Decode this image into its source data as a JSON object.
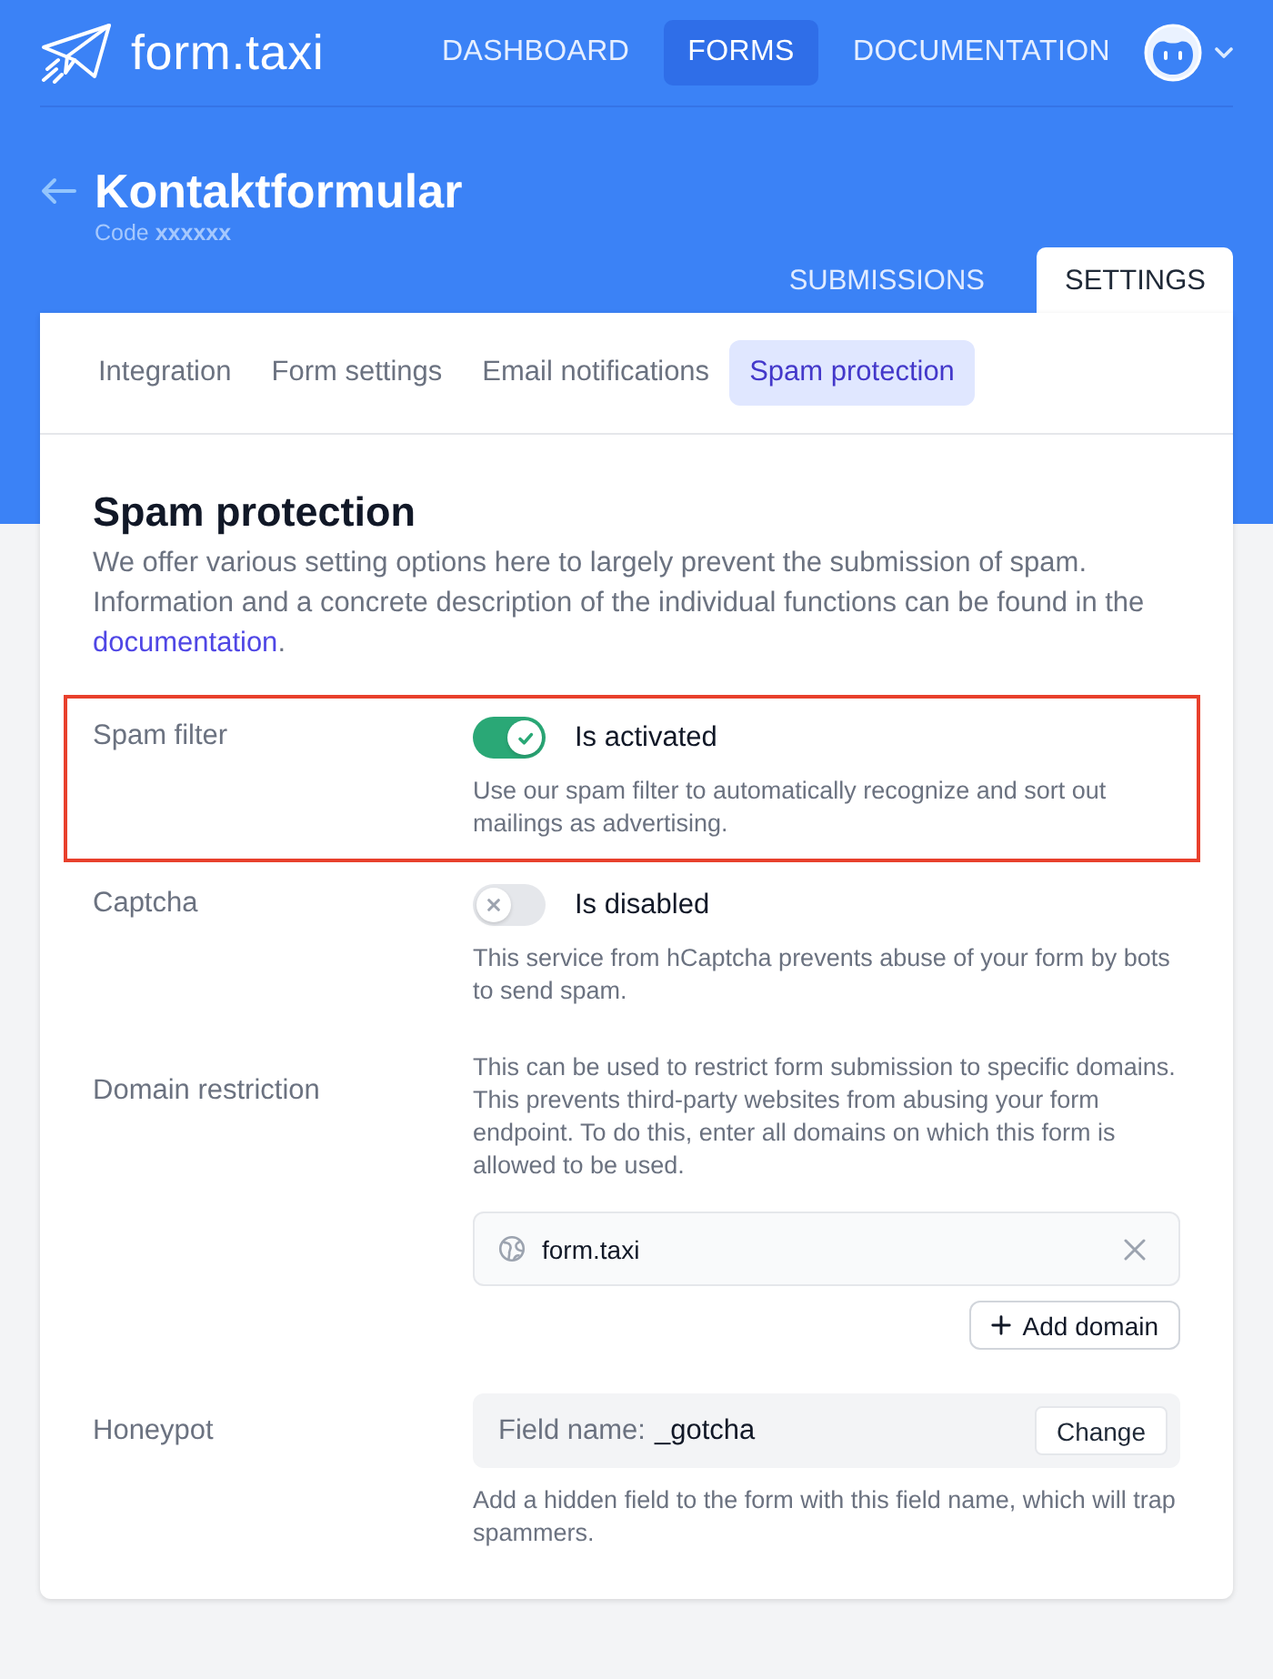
{
  "nav": {
    "logo": "form.taxi",
    "links": [
      {
        "label": "DASHBOARD",
        "selected": false
      },
      {
        "label": "FORMS",
        "selected": true
      },
      {
        "label": "DOCUMENTATION",
        "selected": false
      }
    ]
  },
  "header": {
    "title": "Kontaktformular",
    "code": "Code **xxxxxx**",
    "tabs": [
      {
        "label": "SUBMISSIONS",
        "selected": false
      },
      {
        "label": "SETTINGS",
        "selected": true
      }
    ]
  },
  "subtabs": [
    {
      "label": "Integration",
      "selected": false
    },
    {
      "label": "Form settings",
      "selected": false
    },
    {
      "label": "Email notifications",
      "selected": false
    },
    {
      "label": "Spam protection",
      "selected": true
    }
  ],
  "section": {
    "title": "Spam protection",
    "description": "We offer various setting options here to largely prevent the submission of spam. Information and a concrete description of the individual functions can be found in the",
    "link": "documentation",
    "description_end": "."
  },
  "settings": [
    {
      "kind": "toggle",
      "label": "Spam filter",
      "highlighted": true,
      "on": true,
      "status": "Is activated",
      "description": "Use our spam filter to automatically recognize and sort out mailings as advertising."
    },
    {
      "kind": "toggle",
      "label": "Captcha",
      "highlighted": false,
      "on": false,
      "status": "Is disabled",
      "description": "This service from hCaptcha prevents abuse of your form by bots to send spam."
    },
    {
      "kind": "domains",
      "label": "Domain restriction",
      "highlighted": false,
      "description": "This can be used to restrict form submission to specific domains. This prevents third-party websites from abusing your form endpoint. To do this, enter all domains on which this form is allowed to be used.",
      "domains": [
        "form.taxi"
      ],
      "add_button": "Add domain"
    },
    {
      "kind": "honeypot",
      "label": "Honeypot",
      "highlighted": false,
      "field_label": "Field name:",
      "value": "_gotcha",
      "button": "Change",
      "description": "Add a hidden field to the form with this field name, which will trap spammers."
    }
  ]
}
